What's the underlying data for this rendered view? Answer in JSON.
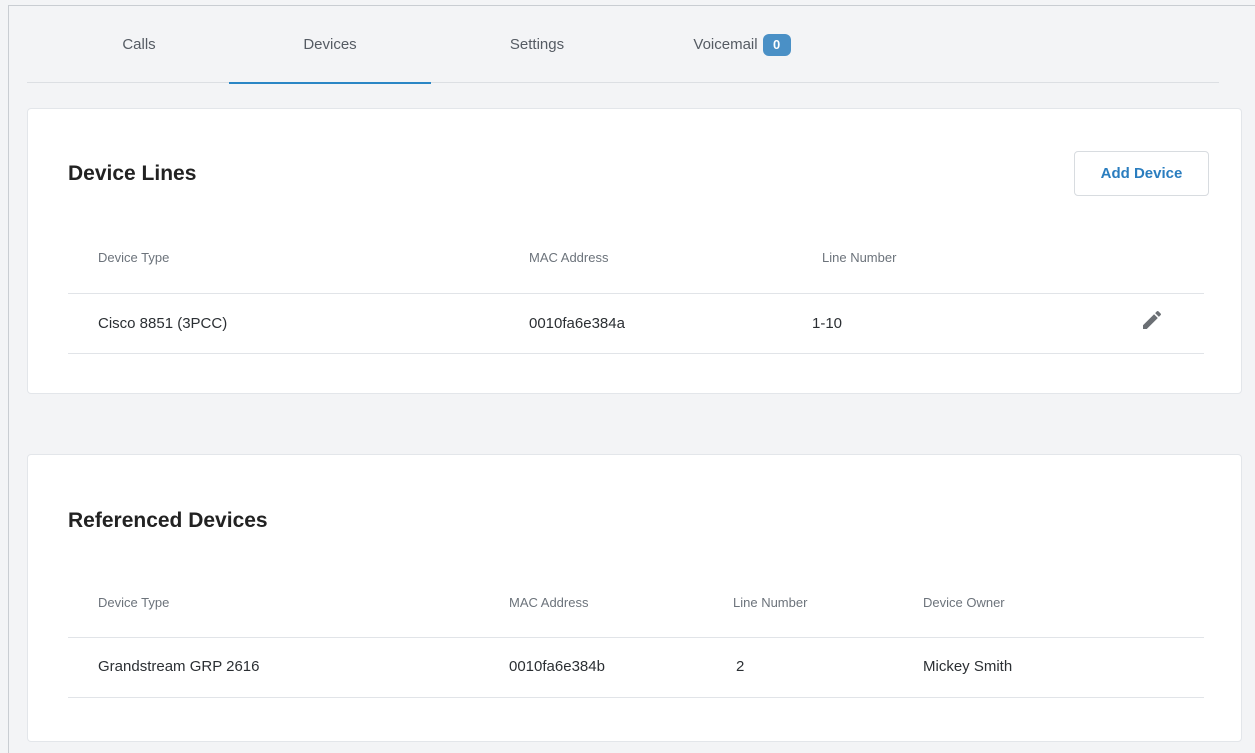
{
  "tabs": [
    {
      "label": "Calls"
    },
    {
      "label": "Devices"
    },
    {
      "label": "Settings"
    },
    {
      "label": "Voicemail",
      "badge": "0"
    }
  ],
  "device_lines": {
    "title": "Device Lines",
    "add_button": "Add Device",
    "columns": [
      "Device Type",
      "MAC Address",
      "Line Number"
    ],
    "rows": [
      {
        "device_type": "Cisco 8851 (3PCC)",
        "mac": "0010fa6e384a",
        "line": "1-10",
        "action_icon": "pencil-icon"
      }
    ]
  },
  "referenced_devices": {
    "title": "Referenced Devices",
    "columns": [
      "Device Type",
      "MAC Address",
      "Line Number",
      "Device Owner"
    ],
    "rows": [
      {
        "device_type": "Grandstream GRP 2616",
        "mac": "0010fa6e384b",
        "line": "2",
        "owner": "Mickey Smith"
      }
    ]
  },
  "colors": {
    "accent": "#2a86c5",
    "badge": "#4a90c6",
    "button_text": "#2a7dbf"
  }
}
